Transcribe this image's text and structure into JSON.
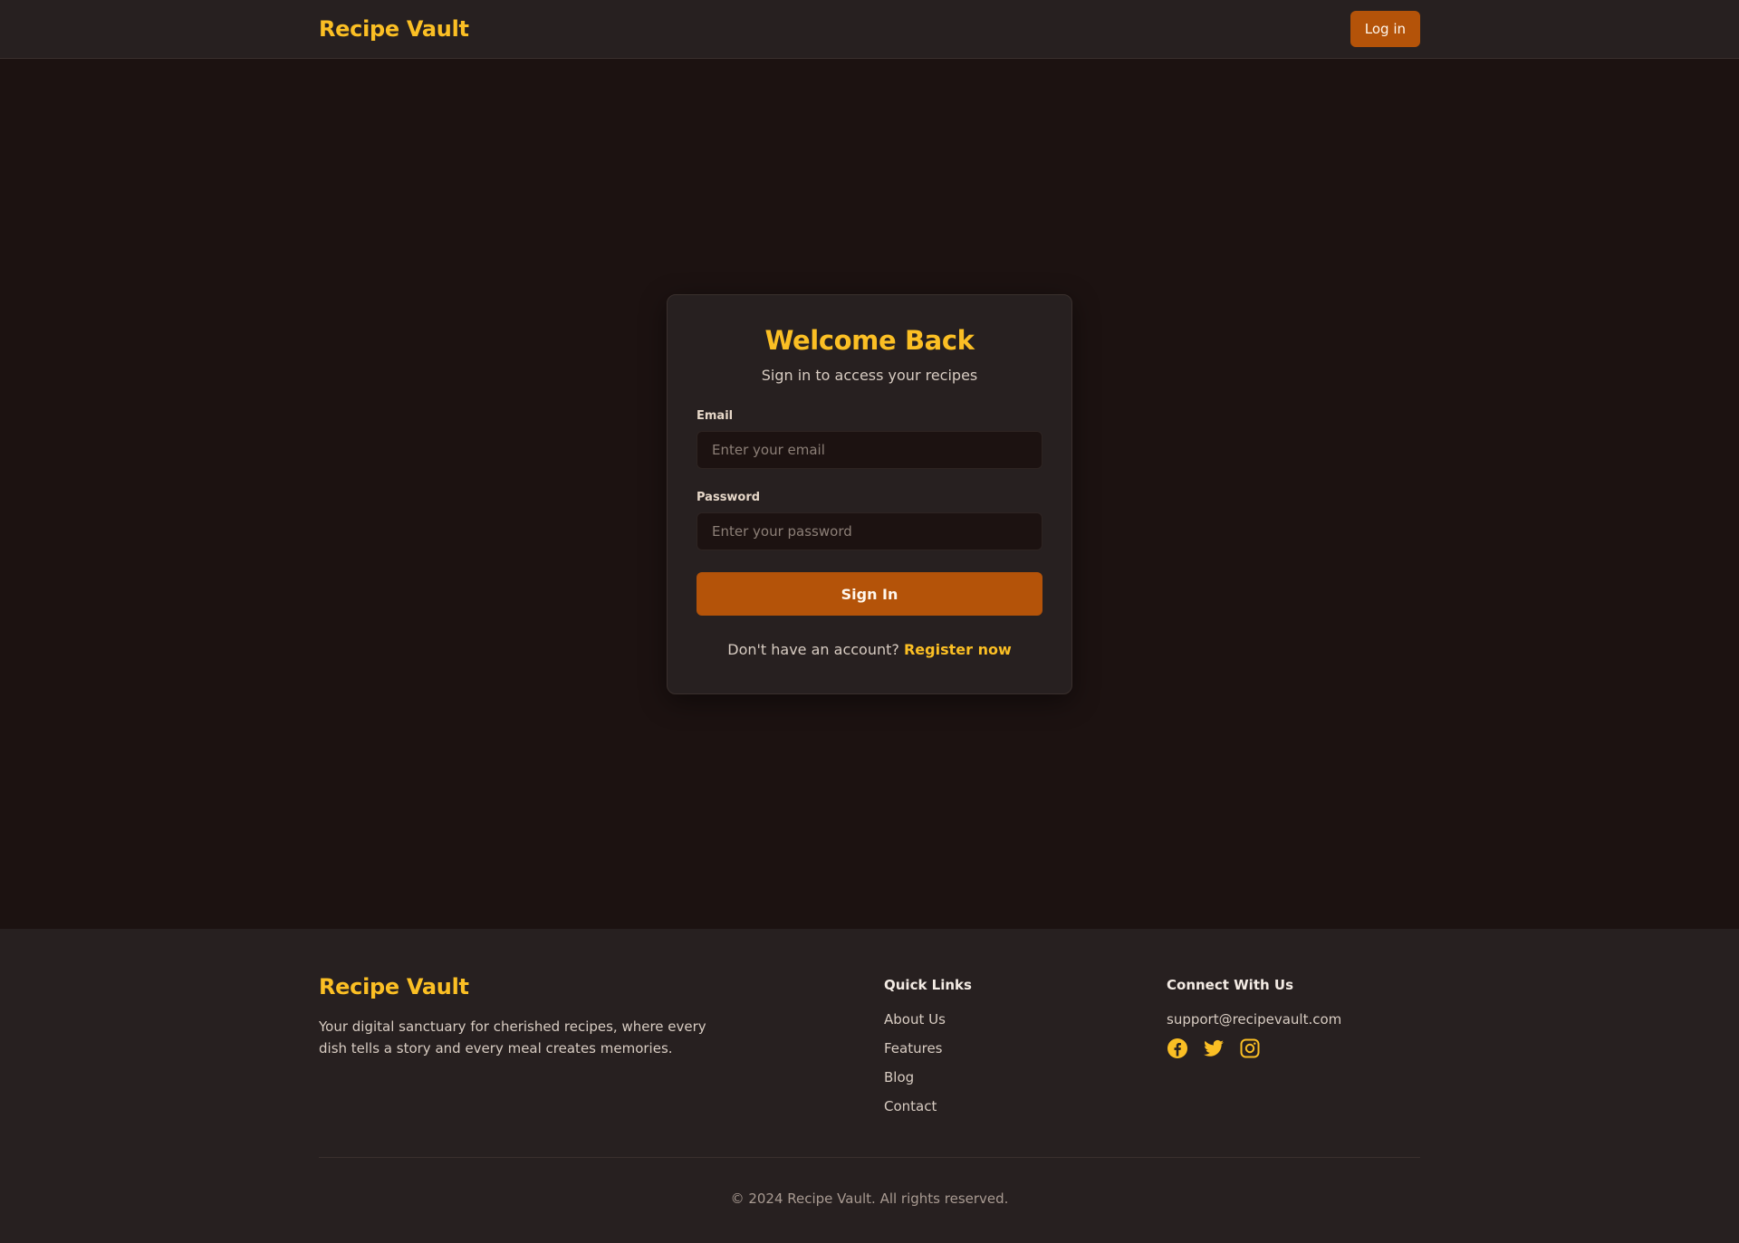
{
  "header": {
    "brand": "Recipe Vault",
    "login_label": "Log in"
  },
  "login_card": {
    "title": "Welcome Back",
    "subtitle": "Sign in to access your recipes",
    "email_label": "Email",
    "email_placeholder": "Enter your email",
    "email_value": "",
    "password_label": "Password",
    "password_placeholder": "Enter your password",
    "password_value": "",
    "submit_label": "Sign In",
    "register_prompt": "Don't have an account?",
    "register_link": "Register now"
  },
  "footer": {
    "brand": "Recipe Vault",
    "description": "Your digital sanctuary for cherished recipes, where every dish tells a story and every meal creates memories.",
    "quick_links_heading": "Quick Links",
    "quick_links": [
      {
        "label": "About Us"
      },
      {
        "label": "Features"
      },
      {
        "label": "Blog"
      },
      {
        "label": "Contact"
      }
    ],
    "connect_heading": "Connect With Us",
    "email": "support@recipevault.com",
    "social_icons": [
      "facebook-icon",
      "twitter-icon",
      "instagram-icon"
    ],
    "copyright": "© 2024 Recipe Vault. All rights reserved."
  },
  "colors": {
    "accent": "#fbbf24",
    "primary_button": "#b45309",
    "background": "#1c1211",
    "surface": "#272020"
  }
}
